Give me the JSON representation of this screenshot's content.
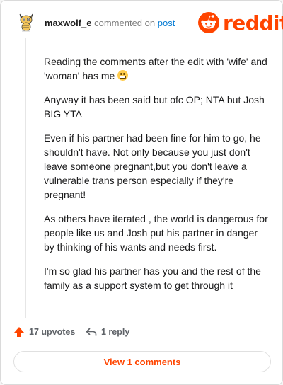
{
  "header": {
    "username": "maxwolf_e",
    "commented_text": "commented on",
    "post_link": "post",
    "brand": "reddit"
  },
  "comment": {
    "paragraphs": [
      "Reading the comments after the edit with 'wife' and 'woman' has me",
      "Anyway it has been said but ofc OP; NTA but Josh BIG YTA",
      "Even if his partner had been fine for him to go, he shouldn't have. Not only because you just don't leave someone pregnant,but you don't leave a vulnerable trans person especially if they're pregnant!",
      "As others have iterated , the world is dangerous for people like us and Josh put his partner in danger by thinking of his wants and needs first.",
      "I'm so glad his partner has you and the rest of the family as a support system to get through it"
    ]
  },
  "actions": {
    "upvotes": "17 upvotes",
    "replies": "1 reply",
    "view_button": "View 1 comments"
  },
  "colors": {
    "brand": "#ff4500",
    "link": "#0079d3"
  },
  "icons": {
    "avatar": "snoo-avatar-icon",
    "logo": "reddit-logo-icon",
    "emoji": "grimacing-face-icon",
    "upvote": "upvote-arrow-icon",
    "reply": "reply-arrow-icon"
  }
}
